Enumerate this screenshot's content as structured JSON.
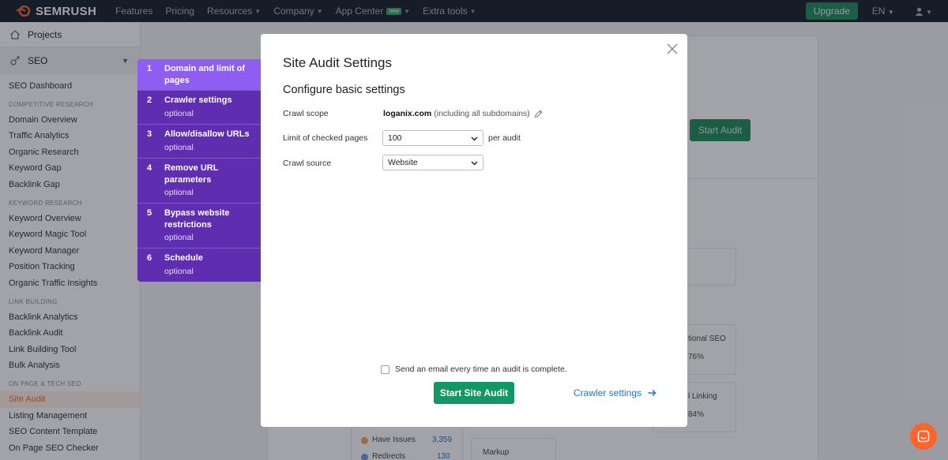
{
  "topnav": {
    "logo": "SEMRUSH",
    "links": [
      {
        "label": "Features",
        "has_chevron": false
      },
      {
        "label": "Pricing",
        "has_chevron": false
      },
      {
        "label": "Resources",
        "has_chevron": true
      },
      {
        "label": "Company",
        "has_chevron": true
      },
      {
        "label": "App Center",
        "has_chevron": true,
        "badge": "new"
      },
      {
        "label": "Extra tools",
        "has_chevron": true
      }
    ],
    "upgrade_label": "Upgrade",
    "lang_label": "EN",
    "user_icon": "user-icon"
  },
  "sidebar": {
    "projects_label": "Projects",
    "seo_label": "SEO",
    "dashboard": "SEO Dashboard",
    "sections": [
      {
        "title": "COMPETITIVE RESEARCH",
        "items": [
          "Domain Overview",
          "Traffic Analytics",
          "Organic Research",
          "Keyword Gap",
          "Backlink Gap"
        ]
      },
      {
        "title": "KEYWORD RESEARCH",
        "items": [
          "Keyword Overview",
          "Keyword Magic Tool",
          "Keyword Manager",
          "Position Tracking",
          "Organic Traffic Insights"
        ]
      },
      {
        "title": "LINK BUILDING",
        "items": [
          "Backlink Analytics",
          "Backlink Audit",
          "Link Building Tool",
          "Bulk Analysis"
        ]
      },
      {
        "title": "ON PAGE & TECH SEO",
        "items": [
          "Site Audit",
          "Listing Management",
          "SEO Content Template",
          "On Page SEO Checker"
        ]
      }
    ],
    "active_item": "Site Audit"
  },
  "background": {
    "start_audit_label": "Start Audit",
    "tile_international": "tional SEO",
    "tile_international_pct": "76%",
    "tile_linking": "l Linking",
    "tile_linking_pct": "84%",
    "have_issues_label": "Have Issues",
    "have_issues_value": "3,359",
    "redirects_label": "Redirects",
    "redirects_value": "130",
    "markup_label": "Markup",
    "have_issues_color": "#f4a259",
    "redirects_color": "#6f9ae6"
  },
  "steps": [
    {
      "num": "1",
      "title": "Domain and limit of pages",
      "optional": ""
    },
    {
      "num": "2",
      "title": "Crawler settings",
      "optional": "optional"
    },
    {
      "num": "3",
      "title": "Allow/disallow URLs",
      "optional": "optional"
    },
    {
      "num": "4",
      "title": "Remove URL parameters",
      "optional": "optional"
    },
    {
      "num": "5",
      "title": "Bypass website restrictions",
      "optional": "optional"
    },
    {
      "num": "6",
      "title": "Schedule",
      "optional": "optional"
    }
  ],
  "modal": {
    "title": "Site Audit Settings",
    "subtitle": "Configure basic settings",
    "crawl_scope_label": "Crawl scope",
    "crawl_scope_domain": "loganix.com",
    "crawl_scope_note": "(including all subdomains)",
    "limit_label": "Limit of checked pages",
    "limit_value": "100",
    "per_audit": "per audit",
    "source_label": "Crawl source",
    "source_value": "Website",
    "email_label": "Send an email every time an audit is complete.",
    "email_checked": false,
    "start_label": "Start Site Audit",
    "next_label": "Crawler settings"
  },
  "colors": {
    "brand_orange": "#ff642d",
    "step_purple": "#5f2eb0",
    "step_active": "#8e5ef2",
    "primary_green": "#149767",
    "link_blue": "#1e76c9"
  }
}
